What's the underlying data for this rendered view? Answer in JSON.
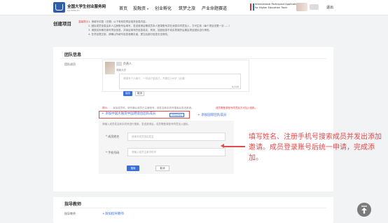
{
  "header": {
    "brand_name": "全国大学生创业服务网",
    "brand_sub": "cy.ncss.cn",
    "nav": [
      {
        "label": "首页"
      },
      {
        "label": "投融资"
      },
      {
        "label": "创业孵化"
      },
      {
        "label": "筑梦之旅"
      },
      {
        "label": "产业命题赛道"
      }
    ],
    "intl_line1": "International Participant Application",
    "intl_line2": "for Higher Education Track",
    "user_name": "退出"
  },
  "page": {
    "title": "创建项目",
    "notice_label": "温馨提示",
    "notices": [
      "1. 请填写中国（无锡）以下有效的项目相关信息内容。",
      "2. 团队成员信息由本人注册账号后填写，发送邀请后需成员本人登录账号并在消息中同意加入，方可生效（每个项目仅限一次……）",
      "3. 请按实际情况填写项目信息，并保证填写的信息真实、有效，如因信息不真实导致的后果由项目团队自行承担。",
      "4. 在项目提交前，请确认所填写信息准确无误，提交后部分信息无法修改。"
    ]
  },
  "team": {
    "title": "团队信息",
    "members_label": "团队成员",
    "member_role": "负责人",
    "member_school": "湖南大学",
    "intro_placeholder": "请填写个人简介，一句话介绍自己，不超过100字（必填）",
    "intro_count": "0/100",
    "save_label": "保存",
    "cancel_label": "取消",
    "tip_label": "提示：",
    "tip_text": "添加成员时，请先确认成员已注册账号，按姓名和手机号搜索后发送邀请。",
    "tip_warn": "成员需登录账号同意后方可加入团队。",
    "add_cn_label": "+ 添加中国大陆及中国港澳台团队成员",
    "add_cn_tag": "(须真实姓名)",
    "add_intl_label": "+ 添加国际团队成员",
    "search_hint": "请输入成员姓名和手机号进行搜索，发送邀请后，成员需登录账号同意加入团队。",
    "name_label": "* 成员姓名",
    "name_placeholder": "请填写成员真实姓名",
    "phone_label": "* 手机号码",
    "phone_placeholder": "请输入成员注册手机号",
    "search_label": "搜索",
    "search_cancel_label": "取消"
  },
  "annotation": {
    "text": "填写姓名、注册手机号搜索成员并发出添加邀请。成员登录账号后统一申请，完成添加。"
  },
  "mentor": {
    "title": "指导教师",
    "label": "指导教师",
    "add_label": "+添加指导教师"
  },
  "colors": {
    "primary": "#3a6fd8",
    "annotation_red": "#e34b4b",
    "brand_blue": "#2f5da8"
  }
}
